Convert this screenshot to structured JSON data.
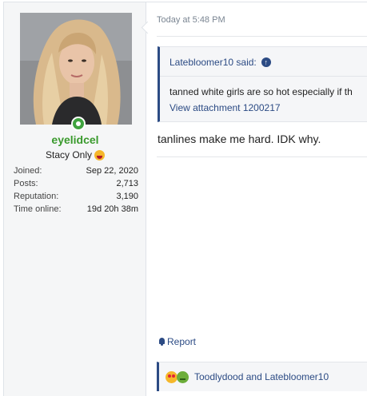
{
  "user": {
    "username": "eyelidcel",
    "title": "Stacy Only",
    "title_emoji": "drooling-face",
    "stats": [
      {
        "label": "Joined:",
        "value": "Sep 22, 2020"
      },
      {
        "label": "Posts:",
        "value": "2,713"
      },
      {
        "label": "Reputation:",
        "value": "3,190"
      },
      {
        "label": "Time online:",
        "value": "19d 20h 38m"
      }
    ]
  },
  "post": {
    "timestamp": "Today at 5:48 PM",
    "quote": {
      "author_line": "Latebloomer10 said:",
      "text": "tanned white girls are so hot especially if th",
      "attachment_link": "View attachment 1200217"
    },
    "body": "tanlines make me hard. IDK why.",
    "report_label": "Report",
    "reactions": {
      "icons": [
        "love-eyes-emoji",
        "sick-emoji"
      ],
      "text": "Toodlydood and Latebloomer10"
    }
  },
  "colors": {
    "username": "#3a9a2d",
    "link": "#2c4b84",
    "sidebar_bg": "#f5f6f7",
    "online": "#3fa33f"
  }
}
